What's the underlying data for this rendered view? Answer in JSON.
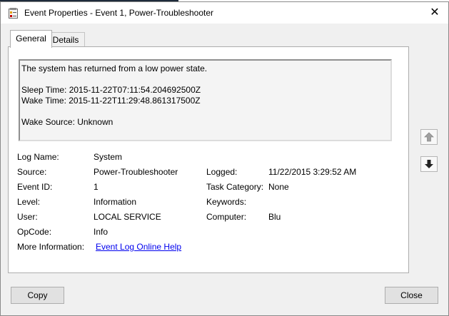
{
  "window": {
    "title": "Event Properties - Event 1, Power-Troubleshooter",
    "close_icon": "close-icon"
  },
  "tabs": [
    {
      "label": "General",
      "active": true
    },
    {
      "label": "Details",
      "active": false
    }
  ],
  "description": {
    "line1": "The system has returned from a low power state.",
    "sleep_time": "Sleep Time: 2015-11-22T07:11:54.204692500Z",
    "wake_time": "Wake Time: 2015-11-22T11:29:48.861317500Z",
    "wake_source": "Wake Source: Unknown"
  },
  "fields": {
    "log_name": {
      "label": "Log Name:",
      "value": "System"
    },
    "source": {
      "label": "Source:",
      "value": "Power-Troubleshooter"
    },
    "event_id": {
      "label": "Event ID:",
      "value": "1"
    },
    "level": {
      "label": "Level:",
      "value": "Information"
    },
    "user": {
      "label": "User:",
      "value": "LOCAL SERVICE"
    },
    "opcode": {
      "label": "OpCode:",
      "value": "Info"
    },
    "more_info": {
      "label": "More Information:",
      "link": "Event Log Online Help"
    },
    "logged": {
      "label": "Logged:",
      "value": "11/22/2015 3:29:52 AM"
    },
    "task_category": {
      "label": "Task Category:",
      "value": "None"
    },
    "keywords": {
      "label": "Keywords:",
      "value": ""
    },
    "computer": {
      "label": "Computer:",
      "value": "Blu"
    }
  },
  "buttons": {
    "copy": "Copy",
    "close": "Close"
  },
  "colors": {
    "link": "#0000ee",
    "nav_arrow_up": "#a0a0a0",
    "nav_arrow_down": "#222222"
  }
}
